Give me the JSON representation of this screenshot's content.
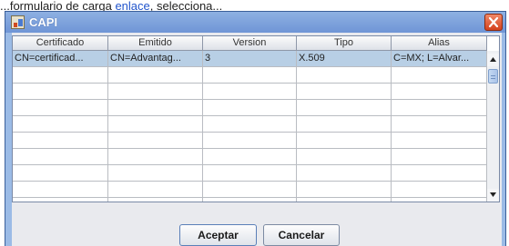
{
  "background": {
    "text_before": "...formulario de carga ",
    "link_text": "enlace",
    "text_after": ", selecciona..."
  },
  "window": {
    "title": "CAPI",
    "accent": "#6f95d6",
    "close_icon": "close-icon",
    "app_icon": "java-app-icon"
  },
  "table": {
    "columns": [
      "Certificado",
      "Emitido",
      "Version",
      "Tipo",
      "Alias"
    ],
    "rows": [
      [
        "CN=certificad...",
        "CN=Advantag...",
        "3",
        "X.509",
        "C=MX; L=Alvar..."
      ],
      [
        "",
        "",
        "",
        "",
        ""
      ],
      [
        "",
        "",
        "",
        "",
        ""
      ],
      [
        "",
        "",
        "",
        "",
        ""
      ],
      [
        "",
        "",
        "",
        "",
        ""
      ],
      [
        "",
        "",
        "",
        "",
        ""
      ],
      [
        "",
        "",
        "",
        "",
        ""
      ],
      [
        "",
        "",
        "",
        "",
        ""
      ],
      [
        "",
        "",
        "",
        "",
        ""
      ],
      [
        "",
        "",
        "",
        "",
        ""
      ]
    ],
    "selected_row": 0,
    "selection_color": "#b8cfe5"
  },
  "buttons": {
    "accept_label": "Aceptar",
    "cancel_label": "Cancelar"
  }
}
